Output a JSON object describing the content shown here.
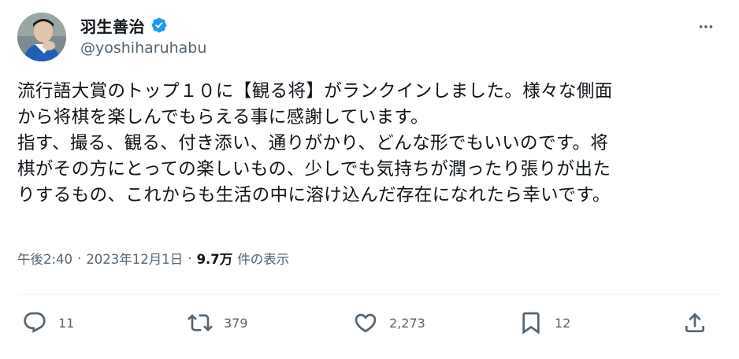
{
  "author": {
    "display_name": "羽生善治",
    "handle": "@yoshiharuhabu",
    "verified": true
  },
  "tweet": {
    "text": "流行語大賞のトップ１０に【観る将】がランクインしました。様々な側面\nから将棋を楽しんでもらえる事に感謝しています。\n指す、撮る、観る、付き添い、通りがかり、どんな形でもいいのです。将\n棋がその方にとっての楽しいもの、少しでも気持ちが潤ったり張りが出た\nりするもの、これからも生活の中に溶け込んだ存在になれたら幸いです。",
    "time": "午後2:40",
    "separator": "·",
    "date": "2023年12月1日",
    "views_count": "9.7万",
    "views_label": "件の表示"
  },
  "actions": {
    "replies": "11",
    "retweets": "379",
    "likes": "2,273",
    "bookmarks": "12"
  },
  "colors": {
    "text_primary": "#0f1419",
    "text_secondary": "#536471",
    "verified_blue": "#1d9bf0",
    "divider": "#eff3f4"
  },
  "icons": {
    "more": "more-horizontal-icon",
    "reply": "reply-icon",
    "retweet": "retweet-icon",
    "like": "heart-icon",
    "bookmark": "bookmark-icon",
    "share": "share-icon",
    "verified": "verified-badge-icon"
  }
}
